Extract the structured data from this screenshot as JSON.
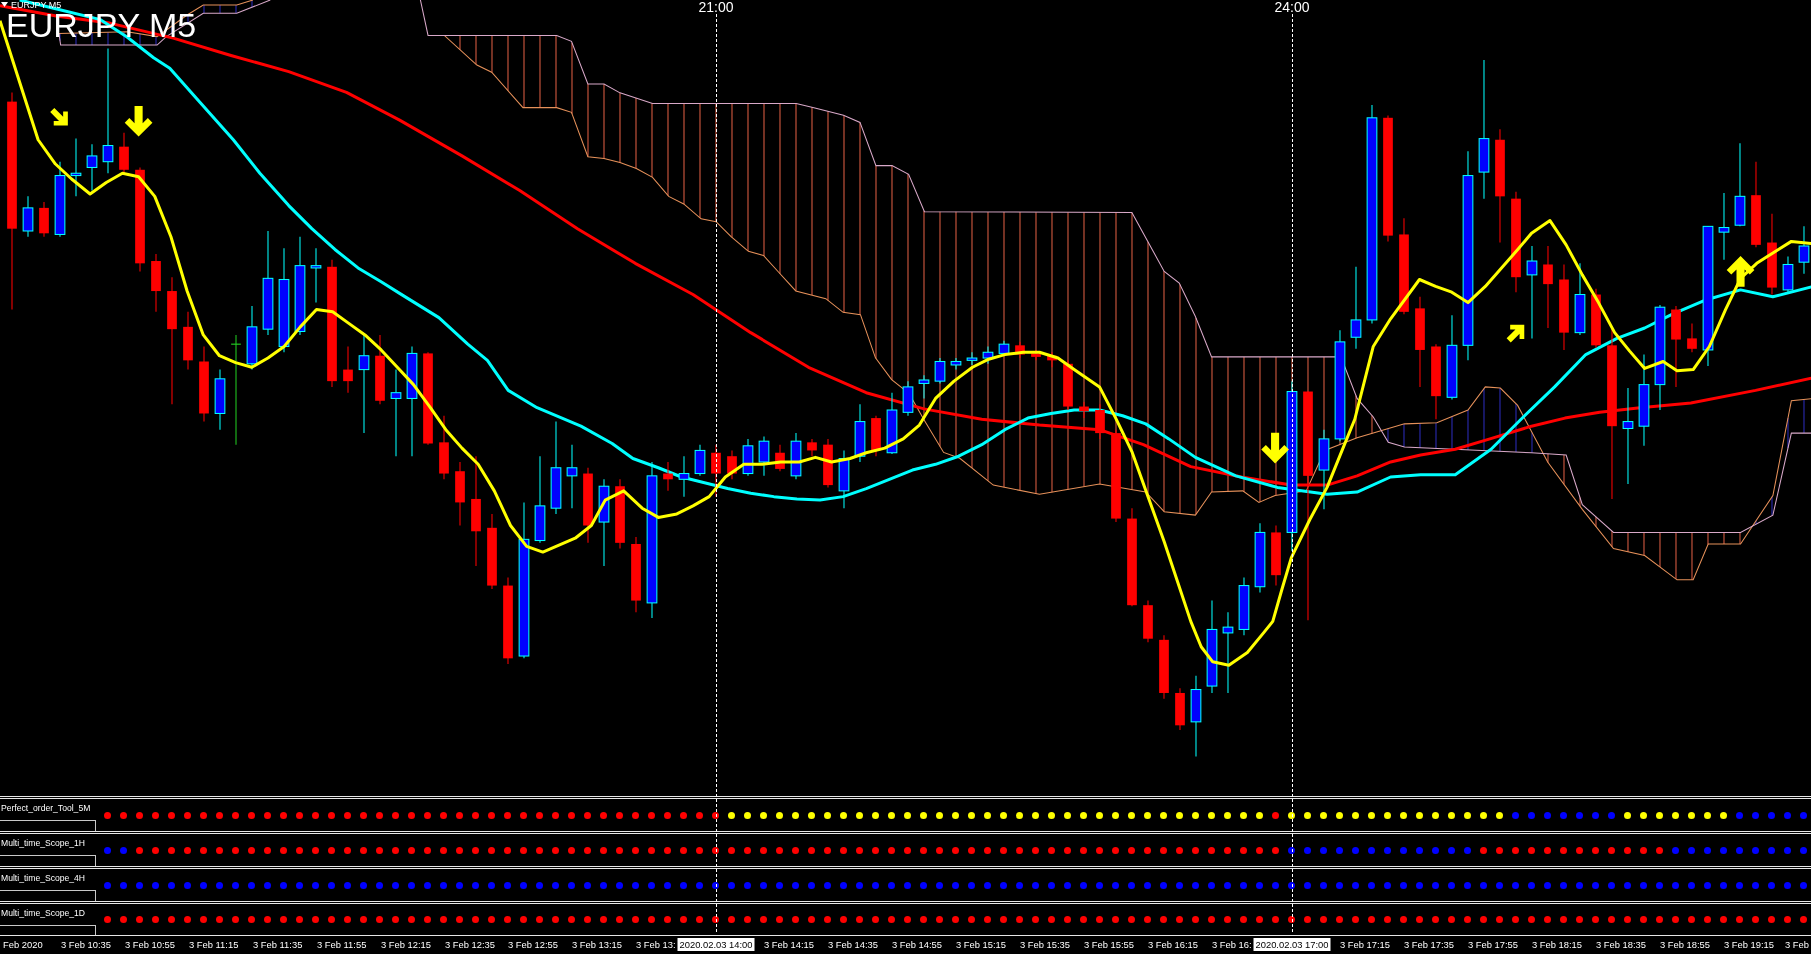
{
  "chart": {
    "header": "EURJPY M5",
    "title": "EURJPY M5",
    "markers": [
      {
        "label": "21:00"
      },
      {
        "label": "24:00"
      }
    ]
  },
  "indicators": [
    {
      "label": "Perfect_order_Tool_5M",
      "dots": [
        {
          "color": "#ff0000"
        },
        {
          "color": "#ff0000"
        },
        {
          "color": "#ff0000"
        },
        {
          "color": "#ff0000"
        },
        {
          "color": "#ff0000"
        },
        {
          "color": "#ff0000"
        },
        {
          "color": "#ff0000"
        },
        {
          "color": "#ff0000"
        },
        {
          "color": "#ff0000"
        },
        {
          "color": "#ff0000"
        },
        {
          "color": "#ff0000"
        },
        {
          "color": "#ff0000"
        },
        {
          "color": "#ff0000"
        },
        {
          "color": "#ff0000"
        },
        {
          "color": "#ff0000"
        },
        {
          "color": "#ff0000"
        },
        {
          "color": "#ff0000"
        },
        {
          "color": "#ff0000"
        },
        {
          "color": "#ff0000"
        },
        {
          "color": "#ff0000"
        },
        {
          "color": "#ff0000"
        },
        {
          "color": "#ff0000"
        },
        {
          "color": "#ff0000"
        },
        {
          "color": "#ff0000"
        },
        {
          "color": "#ff0000"
        },
        {
          "color": "#ff0000"
        },
        {
          "color": "#ff0000"
        },
        {
          "color": "#ff0000"
        },
        {
          "color": "#ff0000"
        },
        {
          "color": "#ff0000"
        },
        {
          "color": "#ff0000"
        },
        {
          "color": "#ff0000"
        },
        {
          "color": "#ff0000"
        },
        {
          "color": "#ff0000"
        },
        {
          "color": "#ff0000"
        },
        {
          "color": "#ff0000"
        },
        {
          "color": "#ff0000"
        },
        {
          "color": "#ff0000"
        },
        {
          "color": "#ff0000"
        },
        {
          "color": "#ffff00"
        },
        {
          "color": "#ffff00"
        },
        {
          "color": "#ffff00"
        },
        {
          "color": "#ffff00"
        },
        {
          "color": "#ffff00"
        },
        {
          "color": "#ffff00"
        },
        {
          "color": "#ffff00"
        },
        {
          "color": "#ffff00"
        },
        {
          "color": "#ffff00"
        },
        {
          "color": "#ffff00"
        },
        {
          "color": "#ffff00"
        },
        {
          "color": "#ffff00"
        },
        {
          "color": "#ffff00"
        },
        {
          "color": "#ffff00"
        },
        {
          "color": "#ffff00"
        },
        {
          "color": "#ffff00"
        },
        {
          "color": "#ffff00"
        },
        {
          "color": "#ffff00"
        },
        {
          "color": "#ffff00"
        },
        {
          "color": "#ffff00"
        },
        {
          "color": "#ffff00"
        },
        {
          "color": "#ffff00"
        },
        {
          "color": "#ffff00"
        },
        {
          "color": "#ffff00"
        },
        {
          "color": "#ffff00"
        },
        {
          "color": "#ffff00"
        },
        {
          "color": "#ffff00"
        },
        {
          "color": "#ffff00"
        },
        {
          "color": "#ffff00"
        },
        {
          "color": "#ffff00"
        },
        {
          "color": "#ffff00"
        },
        {
          "color": "#ffff00"
        },
        {
          "color": "#ffff00"
        },
        {
          "color": "#ffff00"
        },
        {
          "color": "#ff0000"
        },
        {
          "color": "#ffff00"
        },
        {
          "color": "#ffff00"
        },
        {
          "color": "#ffff00"
        },
        {
          "color": "#ffff00"
        },
        {
          "color": "#ffff00"
        },
        {
          "color": "#ffff00"
        },
        {
          "color": "#ffff00"
        },
        {
          "color": "#ffff00"
        },
        {
          "color": "#ffff00"
        },
        {
          "color": "#ffff00"
        },
        {
          "color": "#ffff00"
        },
        {
          "color": "#ffff00"
        },
        {
          "color": "#ffff00"
        },
        {
          "color": "#ffff00"
        },
        {
          "color": "#0000ff"
        },
        {
          "color": "#0000ff"
        },
        {
          "color": "#0000ff"
        },
        {
          "color": "#0000ff"
        },
        {
          "color": "#0000ff"
        },
        {
          "color": "#0000ff"
        },
        {
          "color": "#0000ff"
        },
        {
          "color": "#ffff00"
        },
        {
          "color": "#ffff00"
        },
        {
          "color": "#ffff00"
        },
        {
          "color": "#ffff00"
        },
        {
          "color": "#ffff00"
        },
        {
          "color": "#ffff00"
        },
        {
          "color": "#ffff00"
        },
        {
          "color": "#0000ff"
        },
        {
          "color": "#0000ff"
        },
        {
          "color": "#0000ff"
        },
        {
          "color": "#0000ff"
        },
        {
          "color": "#0000ff"
        }
      ]
    },
    {
      "label": "Multi_time_Scope_1H",
      "dots": [
        {
          "color": "#0000ff"
        },
        {
          "color": "#0000ff"
        },
        {
          "color": "#ff0000"
        },
        {
          "color": "#ff0000"
        },
        {
          "color": "#ff0000"
        },
        {
          "color": "#ff0000"
        },
        {
          "color": "#ff0000"
        },
        {
          "color": "#ff0000"
        },
        {
          "color": "#ff0000"
        },
        {
          "color": "#ff0000"
        },
        {
          "color": "#ff0000"
        },
        {
          "color": "#ff0000"
        },
        {
          "color": "#ff0000"
        },
        {
          "color": "#ff0000"
        },
        {
          "color": "#ff0000"
        },
        {
          "color": "#ff0000"
        },
        {
          "color": "#ff0000"
        },
        {
          "color": "#ff0000"
        },
        {
          "color": "#ff0000"
        },
        {
          "color": "#ff0000"
        },
        {
          "color": "#ff0000"
        },
        {
          "color": "#ff0000"
        },
        {
          "color": "#ff0000"
        },
        {
          "color": "#ff0000"
        },
        {
          "color": "#ff0000"
        },
        {
          "color": "#ff0000"
        },
        {
          "color": "#ff0000"
        },
        {
          "color": "#ff0000"
        },
        {
          "color": "#ff0000"
        },
        {
          "color": "#ff0000"
        },
        {
          "color": "#ff0000"
        },
        {
          "color": "#ff0000"
        },
        {
          "color": "#ff0000"
        },
        {
          "color": "#ff0000"
        },
        {
          "color": "#ff0000"
        },
        {
          "color": "#ff0000"
        },
        {
          "color": "#ff0000"
        },
        {
          "color": "#ff0000"
        },
        {
          "color": "#ff0000"
        },
        {
          "color": "#ff0000"
        },
        {
          "color": "#ff0000"
        },
        {
          "color": "#ff0000"
        },
        {
          "color": "#ff0000"
        },
        {
          "color": "#ff0000"
        },
        {
          "color": "#ff0000"
        },
        {
          "color": "#ff0000"
        },
        {
          "color": "#ff0000"
        },
        {
          "color": "#ff0000"
        },
        {
          "color": "#ff0000"
        },
        {
          "color": "#ff0000"
        },
        {
          "color": "#ff0000"
        },
        {
          "color": "#ff0000"
        },
        {
          "color": "#ff0000"
        },
        {
          "color": "#ff0000"
        },
        {
          "color": "#ff0000"
        },
        {
          "color": "#ff0000"
        },
        {
          "color": "#ff0000"
        },
        {
          "color": "#ff0000"
        },
        {
          "color": "#ff0000"
        },
        {
          "color": "#ff0000"
        },
        {
          "color": "#ff0000"
        },
        {
          "color": "#ff0000"
        },
        {
          "color": "#ff0000"
        },
        {
          "color": "#ff0000"
        },
        {
          "color": "#ff0000"
        },
        {
          "color": "#ff0000"
        },
        {
          "color": "#ff0000"
        },
        {
          "color": "#ff0000"
        },
        {
          "color": "#ff0000"
        },
        {
          "color": "#ff0000"
        },
        {
          "color": "#ff0000"
        },
        {
          "color": "#ff0000"
        },
        {
          "color": "#ff0000"
        },
        {
          "color": "#ff0000"
        },
        {
          "color": "#0000ff"
        },
        {
          "color": "#0000ff"
        },
        {
          "color": "#0000ff"
        },
        {
          "color": "#0000ff"
        },
        {
          "color": "#0000ff"
        },
        {
          "color": "#0000ff"
        },
        {
          "color": "#0000ff"
        },
        {
          "color": "#0000ff"
        },
        {
          "color": "#0000ff"
        },
        {
          "color": "#0000ff"
        },
        {
          "color": "#0000ff"
        },
        {
          "color": "#0000ff"
        },
        {
          "color": "#ff0000"
        },
        {
          "color": "#ff0000"
        },
        {
          "color": "#ff0000"
        },
        {
          "color": "#ff0000"
        },
        {
          "color": "#ff0000"
        },
        {
          "color": "#ff0000"
        },
        {
          "color": "#ff0000"
        },
        {
          "color": "#ff0000"
        },
        {
          "color": "#ff0000"
        },
        {
          "color": "#ff0000"
        },
        {
          "color": "#ff0000"
        },
        {
          "color": "#ff0000"
        },
        {
          "color": "#0000ff"
        },
        {
          "color": "#0000ff"
        },
        {
          "color": "#0000ff"
        },
        {
          "color": "#0000ff"
        },
        {
          "color": "#0000ff"
        },
        {
          "color": "#0000ff"
        },
        {
          "color": "#0000ff"
        },
        {
          "color": "#0000ff"
        },
        {
          "color": "#0000ff"
        }
      ]
    },
    {
      "label": "Multi_time_Scope_4H",
      "dots": [
        {
          "color": "#0000ff"
        },
        {
          "color": "#0000ff"
        },
        {
          "color": "#0000ff"
        },
        {
          "color": "#0000ff"
        },
        {
          "color": "#0000ff"
        },
        {
          "color": "#0000ff"
        },
        {
          "color": "#0000ff"
        },
        {
          "color": "#0000ff"
        },
        {
          "color": "#0000ff"
        },
        {
          "color": "#0000ff"
        },
        {
          "color": "#0000ff"
        },
        {
          "color": "#0000ff"
        },
        {
          "color": "#0000ff"
        },
        {
          "color": "#0000ff"
        },
        {
          "color": "#0000ff"
        },
        {
          "color": "#0000ff"
        },
        {
          "color": "#0000ff"
        },
        {
          "color": "#0000ff"
        },
        {
          "color": "#0000ff"
        },
        {
          "color": "#0000ff"
        },
        {
          "color": "#0000ff"
        },
        {
          "color": "#0000ff"
        },
        {
          "color": "#0000ff"
        },
        {
          "color": "#0000ff"
        },
        {
          "color": "#0000ff"
        },
        {
          "color": "#0000ff"
        },
        {
          "color": "#0000ff"
        },
        {
          "color": "#0000ff"
        },
        {
          "color": "#0000ff"
        },
        {
          "color": "#0000ff"
        },
        {
          "color": "#0000ff"
        },
        {
          "color": "#0000ff"
        },
        {
          "color": "#0000ff"
        },
        {
          "color": "#0000ff"
        },
        {
          "color": "#0000ff"
        },
        {
          "color": "#0000ff"
        },
        {
          "color": "#0000ff"
        },
        {
          "color": "#0000ff"
        },
        {
          "color": "#0000ff"
        },
        {
          "color": "#0000ff"
        },
        {
          "color": "#0000ff"
        },
        {
          "color": "#0000ff"
        },
        {
          "color": "#0000ff"
        },
        {
          "color": "#0000ff"
        },
        {
          "color": "#0000ff"
        },
        {
          "color": "#0000ff"
        },
        {
          "color": "#0000ff"
        },
        {
          "color": "#0000ff"
        },
        {
          "color": "#0000ff"
        },
        {
          "color": "#0000ff"
        },
        {
          "color": "#0000ff"
        },
        {
          "color": "#0000ff"
        },
        {
          "color": "#0000ff"
        },
        {
          "color": "#0000ff"
        },
        {
          "color": "#0000ff"
        },
        {
          "color": "#0000ff"
        },
        {
          "color": "#0000ff"
        },
        {
          "color": "#0000ff"
        },
        {
          "color": "#0000ff"
        },
        {
          "color": "#0000ff"
        },
        {
          "color": "#0000ff"
        },
        {
          "color": "#0000ff"
        },
        {
          "color": "#0000ff"
        },
        {
          "color": "#0000ff"
        },
        {
          "color": "#0000ff"
        },
        {
          "color": "#0000ff"
        },
        {
          "color": "#0000ff"
        },
        {
          "color": "#0000ff"
        },
        {
          "color": "#0000ff"
        },
        {
          "color": "#0000ff"
        },
        {
          "color": "#0000ff"
        },
        {
          "color": "#0000ff"
        },
        {
          "color": "#0000ff"
        },
        {
          "color": "#0000ff"
        },
        {
          "color": "#0000ff"
        },
        {
          "color": "#0000ff"
        },
        {
          "color": "#0000ff"
        },
        {
          "color": "#0000ff"
        },
        {
          "color": "#0000ff"
        },
        {
          "color": "#0000ff"
        },
        {
          "color": "#0000ff"
        },
        {
          "color": "#0000ff"
        },
        {
          "color": "#0000ff"
        },
        {
          "color": "#0000ff"
        },
        {
          "color": "#0000ff"
        },
        {
          "color": "#0000ff"
        },
        {
          "color": "#0000ff"
        },
        {
          "color": "#0000ff"
        },
        {
          "color": "#0000ff"
        },
        {
          "color": "#0000ff"
        },
        {
          "color": "#0000ff"
        },
        {
          "color": "#0000ff"
        },
        {
          "color": "#0000ff"
        },
        {
          "color": "#0000ff"
        },
        {
          "color": "#0000ff"
        },
        {
          "color": "#0000ff"
        },
        {
          "color": "#0000ff"
        },
        {
          "color": "#0000ff"
        },
        {
          "color": "#0000ff"
        },
        {
          "color": "#0000ff"
        },
        {
          "color": "#0000ff"
        },
        {
          "color": "#0000ff"
        },
        {
          "color": "#0000ff"
        },
        {
          "color": "#0000ff"
        },
        {
          "color": "#0000ff"
        },
        {
          "color": "#0000ff"
        },
        {
          "color": "#0000ff"
        }
      ]
    },
    {
      "label": "Multi_time_Scope_1D",
      "dots": [
        {
          "color": "#ff0000"
        },
        {
          "color": "#ff0000"
        },
        {
          "color": "#ff0000"
        },
        {
          "color": "#ff0000"
        },
        {
          "color": "#ff0000"
        },
        {
          "color": "#ff0000"
        },
        {
          "color": "#ff0000"
        },
        {
          "color": "#ff0000"
        },
        {
          "color": "#ff0000"
        },
        {
          "color": "#ff0000"
        },
        {
          "color": "#ff0000"
        },
        {
          "color": "#ff0000"
        },
        {
          "color": "#ff0000"
        },
        {
          "color": "#ff0000"
        },
        {
          "color": "#ff0000"
        },
        {
          "color": "#ff0000"
        },
        {
          "color": "#ff0000"
        },
        {
          "color": "#ff0000"
        },
        {
          "color": "#ff0000"
        },
        {
          "color": "#ff0000"
        },
        {
          "color": "#ff0000"
        },
        {
          "color": "#ff0000"
        },
        {
          "color": "#ff0000"
        },
        {
          "color": "#ff0000"
        },
        {
          "color": "#ff0000"
        },
        {
          "color": "#ff0000"
        },
        {
          "color": "#ff0000"
        },
        {
          "color": "#ff0000"
        },
        {
          "color": "#ff0000"
        },
        {
          "color": "#ff0000"
        },
        {
          "color": "#ff0000"
        },
        {
          "color": "#ff0000"
        },
        {
          "color": "#ff0000"
        },
        {
          "color": "#ff0000"
        },
        {
          "color": "#ff0000"
        },
        {
          "color": "#ff0000"
        },
        {
          "color": "#ff0000"
        },
        {
          "color": "#ff0000"
        },
        {
          "color": "#ff0000"
        },
        {
          "color": "#ff0000"
        },
        {
          "color": "#ff0000"
        },
        {
          "color": "#ff0000"
        },
        {
          "color": "#ff0000"
        },
        {
          "color": "#ff0000"
        },
        {
          "color": "#ff0000"
        },
        {
          "color": "#ff0000"
        },
        {
          "color": "#ff0000"
        },
        {
          "color": "#ff0000"
        },
        {
          "color": "#ff0000"
        },
        {
          "color": "#ff0000"
        },
        {
          "color": "#ff0000"
        },
        {
          "color": "#ff0000"
        },
        {
          "color": "#ff0000"
        },
        {
          "color": "#ff0000"
        },
        {
          "color": "#ff0000"
        },
        {
          "color": "#ff0000"
        },
        {
          "color": "#ff0000"
        },
        {
          "color": "#ff0000"
        },
        {
          "color": "#ff0000"
        },
        {
          "color": "#ff0000"
        },
        {
          "color": "#ff0000"
        },
        {
          "color": "#ff0000"
        },
        {
          "color": "#ff0000"
        },
        {
          "color": "#ff0000"
        },
        {
          "color": "#ff0000"
        },
        {
          "color": "#ff0000"
        },
        {
          "color": "#ff0000"
        },
        {
          "color": "#ff0000"
        },
        {
          "color": "#ff0000"
        },
        {
          "color": "#ff0000"
        },
        {
          "color": "#ff0000"
        },
        {
          "color": "#ff0000"
        },
        {
          "color": "#ff0000"
        },
        {
          "color": "#ff0000"
        },
        {
          "color": "#ff0000"
        },
        {
          "color": "#ff0000"
        },
        {
          "color": "#ff0000"
        },
        {
          "color": "#ff0000"
        },
        {
          "color": "#ff0000"
        },
        {
          "color": "#ff0000"
        },
        {
          "color": "#ff0000"
        },
        {
          "color": "#ff0000"
        },
        {
          "color": "#ff0000"
        },
        {
          "color": "#ff0000"
        },
        {
          "color": "#ff0000"
        },
        {
          "color": "#ff0000"
        },
        {
          "color": "#ff0000"
        },
        {
          "color": "#ff0000"
        },
        {
          "color": "#ff0000"
        },
        {
          "color": "#ff0000"
        },
        {
          "color": "#ff0000"
        },
        {
          "color": "#ff0000"
        },
        {
          "color": "#ff0000"
        },
        {
          "color": "#ff0000"
        },
        {
          "color": "#ff0000"
        },
        {
          "color": "#ff0000"
        },
        {
          "color": "#ff0000"
        },
        {
          "color": "#ff0000"
        },
        {
          "color": "#ff0000"
        },
        {
          "color": "#ff0000"
        },
        {
          "color": "#ff0000"
        },
        {
          "color": "#ff0000"
        },
        {
          "color": "#ff0000"
        },
        {
          "color": "#ff0000"
        },
        {
          "color": "#ff0000"
        },
        {
          "color": "#ff0000"
        },
        {
          "color": "#ff0000"
        }
      ]
    }
  ],
  "time_axis": [
    {
      "kind": "tick",
      "label": "Feb 2020"
    },
    {
      "kind": "tick",
      "label": "3 Feb 10:35"
    },
    {
      "kind": "tick",
      "label": "3 Feb 10:55"
    },
    {
      "kind": "tick",
      "label": "3 Feb 11:15"
    },
    {
      "kind": "tick",
      "label": "3 Feb 11:35"
    },
    {
      "kind": "tick",
      "label": "3 Feb 11:55"
    },
    {
      "kind": "tick",
      "label": "3 Feb 12:15"
    },
    {
      "kind": "tick",
      "label": "3 Feb 12:35"
    },
    {
      "kind": "tick",
      "label": "3 Feb 12:55"
    },
    {
      "kind": "tick",
      "label": "3 Feb 13:15"
    },
    {
      "kind": "tick",
      "label": "3 Feb 13:"
    },
    {
      "kind": "cursor",
      "label": "2020.02.03 14:00"
    },
    {
      "kind": "tick",
      "label": "3 Feb 14:15"
    },
    {
      "kind": "tick",
      "label": "3 Feb 14:35"
    },
    {
      "kind": "tick",
      "label": "3 Feb 14:55"
    },
    {
      "kind": "tick",
      "label": "3 Feb 15:15"
    },
    {
      "kind": "tick",
      "label": "3 Feb 15:35"
    },
    {
      "kind": "tick",
      "label": "3 Feb 15:55"
    },
    {
      "kind": "tick",
      "label": "3 Feb 16:15"
    },
    {
      "kind": "tick",
      "label": "3 Feb 16:"
    },
    {
      "kind": "cursor",
      "label": "2020.02.03 17:00"
    },
    {
      "kind": "tick",
      "label": "3 Feb 17:15"
    },
    {
      "kind": "tick",
      "label": "3 Feb 17:35"
    },
    {
      "kind": "tick",
      "label": "3 Feb 17:55"
    },
    {
      "kind": "tick",
      "label": "3 Feb 18:15"
    },
    {
      "kind": "tick",
      "label": "3 Feb 18:35"
    },
    {
      "kind": "tick",
      "label": "3 Feb 18:55"
    },
    {
      "kind": "tick",
      "label": "3 Feb 19:15"
    },
    {
      "kind": "tick",
      "label": "3 Feb"
    }
  ]
}
